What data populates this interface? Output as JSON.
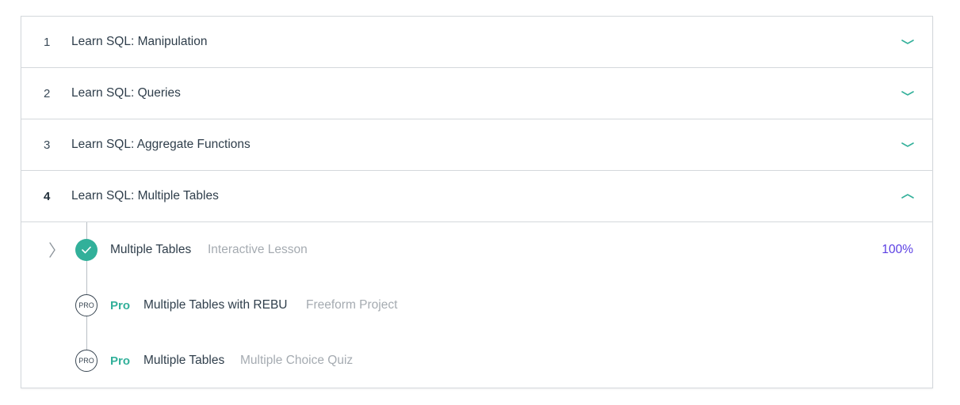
{
  "colors": {
    "accent": "#32b09a",
    "progress": "#5b3fe3",
    "border": "#d4d8dc",
    "muted_text": "#a5abb1"
  },
  "modules": [
    {
      "number": "1",
      "title": "Learn SQL: Manipulation",
      "expanded": false,
      "icon": "chevron-down-icon"
    },
    {
      "number": "2",
      "title": "Learn SQL: Queries",
      "expanded": false,
      "icon": "chevron-down-icon"
    },
    {
      "number": "3",
      "title": "Learn SQL: Aggregate Functions",
      "expanded": false,
      "icon": "chevron-down-icon"
    },
    {
      "number": "4",
      "title": "Learn SQL: Multiple Tables",
      "expanded": true,
      "icon": "chevron-up-icon"
    }
  ],
  "lessons": [
    {
      "title": "Multiple Tables",
      "type": "Interactive Lesson",
      "progress": "100%",
      "status_icon": "checkmark-icon",
      "completed": true
    },
    {
      "pro_badge": "PRO",
      "pro_label": "Pro",
      "title": "Multiple Tables with REBU",
      "type": "Freeform Project",
      "status_icon": "pro-badge-icon"
    },
    {
      "pro_badge": "PRO",
      "pro_label": "Pro",
      "title": "Multiple Tables",
      "type": "Multiple Choice Quiz",
      "status_icon": "pro-badge-icon"
    }
  ]
}
